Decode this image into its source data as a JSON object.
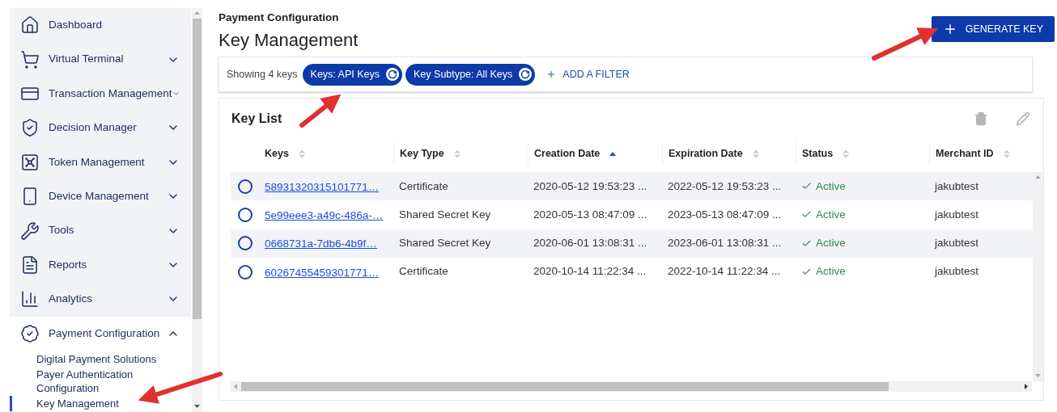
{
  "sidebar": {
    "items": [
      {
        "label": "Dashboard"
      },
      {
        "label": "Virtual Terminal",
        "expanded": false
      },
      {
        "label": "Transaction Management",
        "expanded": false
      },
      {
        "label": "Decision Manager",
        "expanded": false
      },
      {
        "label": "Token Management",
        "expanded": false
      },
      {
        "label": "Device Management",
        "expanded": false
      },
      {
        "label": "Tools",
        "expanded": false
      },
      {
        "label": "Reports",
        "expanded": false
      },
      {
        "label": "Analytics",
        "expanded": false
      },
      {
        "label": "Payment Configuration",
        "expanded": true,
        "children": [
          {
            "label": "Digital Payment Solutions",
            "selected": false
          },
          {
            "label": "Payer Authentication Configuration",
            "selected": false
          },
          {
            "label": "Key Management",
            "selected": true
          }
        ]
      }
    ]
  },
  "header": {
    "breadcrumb": "Payment Configuration",
    "title": "Key Management",
    "action": "GENERATE KEY"
  },
  "filters": {
    "count": "Showing 4 keys",
    "chips": [
      "Keys: API Keys",
      "Key Subtype: All Keys"
    ],
    "add": "ADD A FILTER"
  },
  "table": {
    "title": "Key List",
    "columns": [
      {
        "label": "Keys",
        "sorted": false
      },
      {
        "label": "Key Type",
        "sorted": false
      },
      {
        "label": "Creation Date",
        "sorted": true
      },
      {
        "label": "Expiration Date",
        "sorted": false
      },
      {
        "label": "Status",
        "sorted": false
      },
      {
        "label": "Merchant ID",
        "sorted": false
      }
    ],
    "rows": [
      {
        "selected": false,
        "key": "58931320315101771…",
        "type": "Certificate",
        "created": "2020-05-12 19:53:23 ...",
        "expires": "2022-05-12 19:53:23 ...",
        "status": "Active",
        "merchant": "jakubtest"
      },
      {
        "selected": false,
        "key": "5e99eee3-a49c-486a-…",
        "type": "Shared Secret Key",
        "created": "2020-05-13 08:47:09 ...",
        "expires": "2023-05-13 08:47:09 ...",
        "status": "Active",
        "merchant": "jakubtest"
      },
      {
        "selected": false,
        "key": "0668731a-7db6-4b9f…",
        "type": "Shared Secret Key",
        "created": "2020-06-01 13:08:31 ...",
        "expires": "2023-06-01 13:08:31 ...",
        "status": "Active",
        "merchant": "jakubtest"
      },
      {
        "selected": false,
        "key": "60267455459301771…",
        "type": "Certificate",
        "created": "2020-10-14 11:22:34 ...",
        "expires": "2022-10-14 11:22:34 ...",
        "status": "Active",
        "merchant": "jakubtest"
      }
    ]
  }
}
